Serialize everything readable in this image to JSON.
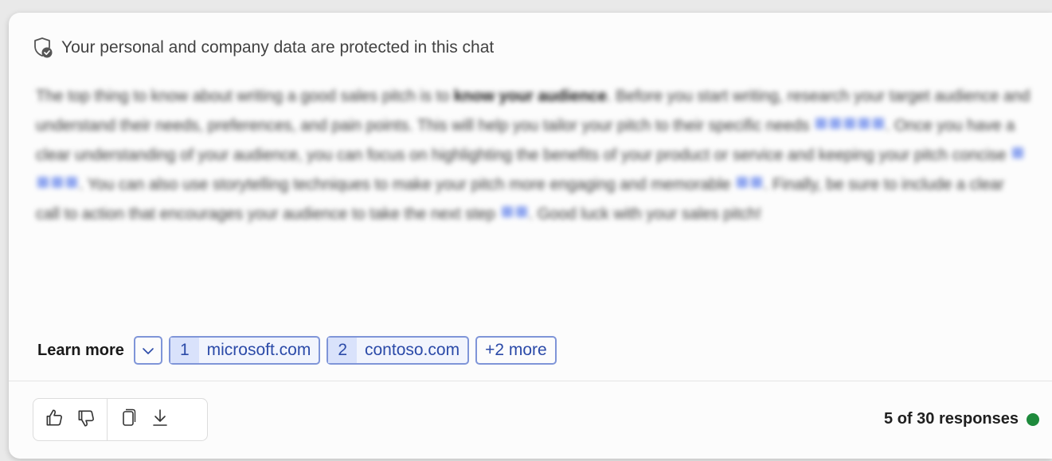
{
  "protection": {
    "icon": "shield-check-icon",
    "text": "Your personal and company data are protected in this chat"
  },
  "answer": {
    "p1": "The top thing to know about writing a good sales pitch is to",
    "bold": "know your audience",
    "p2": ". Before you start writing, research your target audience and understand their needs, preferences, and pain points. This will help you tailor your pitch to their specific needs",
    "p3": ". Once you have a clear understanding of your audience, you can focus on highlighting the benefits of your product or service and keeping your pitch concise",
    "p4": ". You can also use storytelling techniques to make your pitch more engaging and memorable",
    "p5": ". Finally, be sure to include a clear call to action that encourages your audience to take the next step",
    "p6": ". Good luck with your sales pitch!"
  },
  "learn_more": {
    "label": "Learn more",
    "toggle_icon": "chevron-down-icon",
    "sources": [
      {
        "num": "1",
        "domain": "microsoft.com"
      },
      {
        "num": "2",
        "domain": "contoso.com"
      }
    ],
    "more_label": "+2 more"
  },
  "actions": {
    "icons": [
      "thumbs-up-icon",
      "thumbs-down-icon",
      "copy-icon",
      "download-icon"
    ]
  },
  "responses": {
    "text": "5 of 30 responses",
    "status_color": "#1e8a3c"
  }
}
